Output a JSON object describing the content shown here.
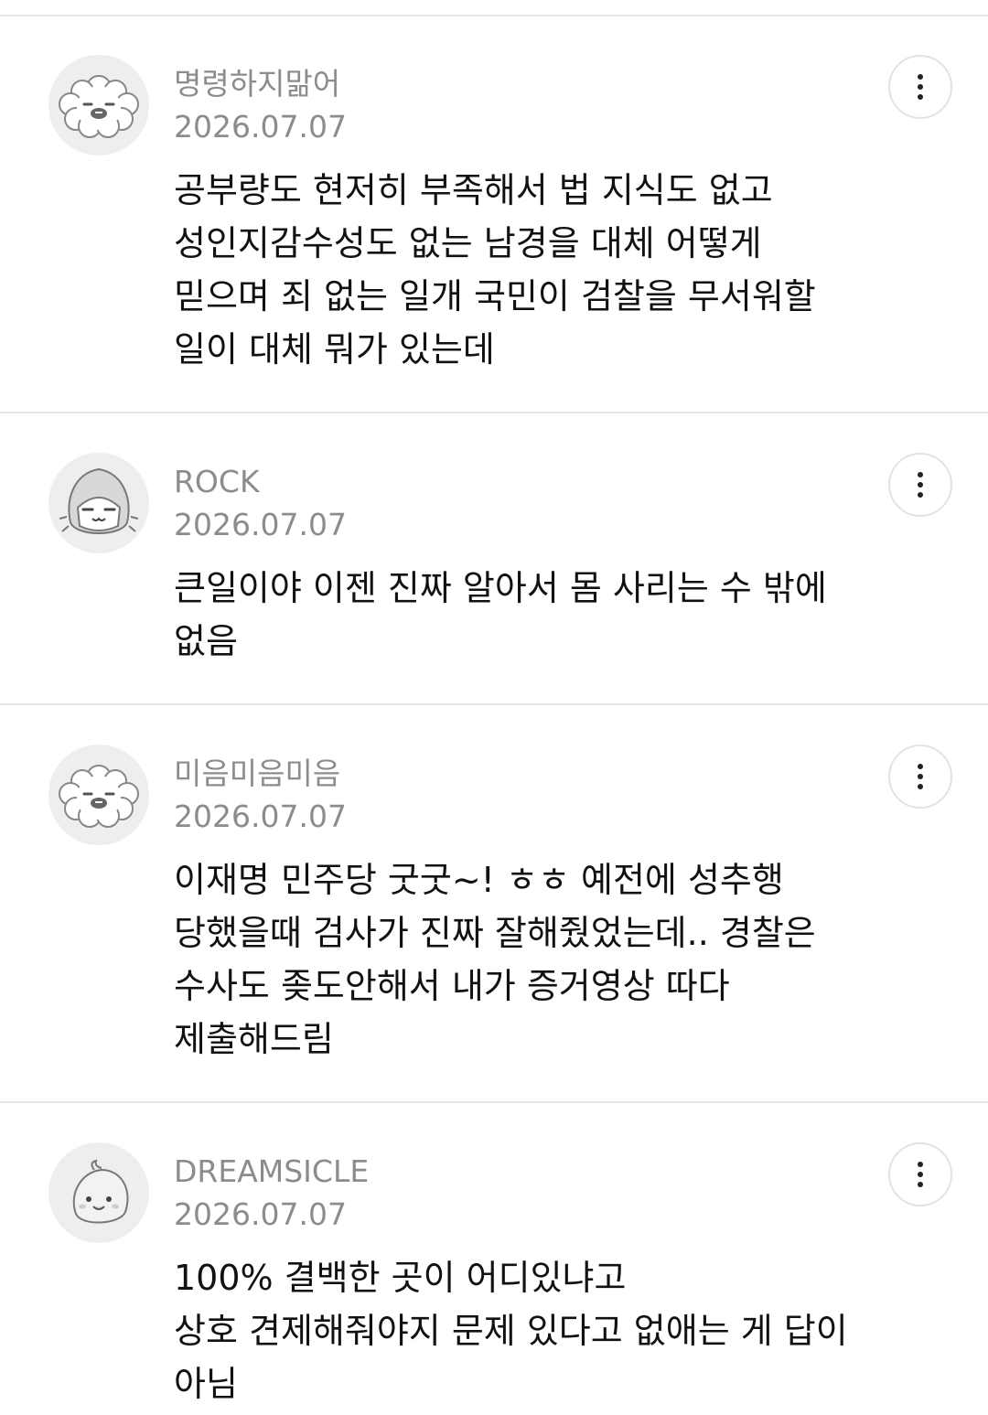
{
  "comments": [
    {
      "author": "명령하지맒어",
      "date": "2026.07.07",
      "text": "공부량도 현저히 부족해서 법 지식도 없고\n성인지감수성도 없는 남경을 대체 어떻게\n믿으며 죄 없는 일개 국민이 검찰을 무서워할\n일이 대체 뭐가 있는데",
      "avatar_icon": "poodle-avatar-icon"
    },
    {
      "author": "ROCK",
      "date": "2026.07.07",
      "text": "큰일이야 이젠 진짜 알아서 몸 사리는 수 밖에\n없음",
      "avatar_icon": "hooded-character-avatar-icon"
    },
    {
      "author": "미음미음미음",
      "date": "2026.07.07",
      "text": "이재명 민주당 굿굿~! ㅎㅎ 예전에 성추행\n당했을때 검사가 진짜 잘해줬었는데.. 경찰은\n수사도 좆도안해서 내가 증거영상 따다\n제출해드림",
      "avatar_icon": "poodle-avatar-icon"
    },
    {
      "author": "DREAMSICLE",
      "date": "2026.07.07",
      "text": "100% 결백한 곳이 어디있냐고\n상호 견제해줘야지 문제 있다고 없애는 게 답이\n아님",
      "avatar_icon": "chick-character-avatar-icon"
    }
  ],
  "more_button_icon": "vertical-ellipsis-icon"
}
